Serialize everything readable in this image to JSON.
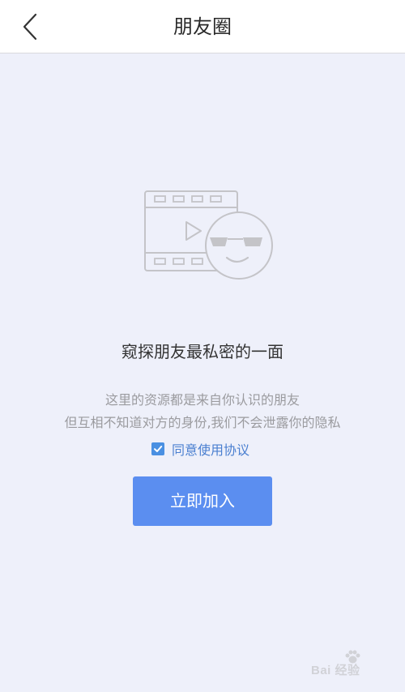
{
  "header": {
    "title": "朋友圈",
    "back_icon": "chevron-left-icon"
  },
  "illustration": {
    "icon": "video-film-sunglasses-face-icon"
  },
  "content": {
    "headline": "窥探朋友最私密的一面",
    "desc_line1": "这里的资源都是来自你认识的朋友",
    "desc_line2": "但互相不知道对方的身份,我们不会泄露你的隐私"
  },
  "agreement": {
    "checked": true,
    "label": "同意使用协议"
  },
  "join_button": {
    "label": "立即加入"
  },
  "watermark": {
    "text": "Bai 经验"
  },
  "colors": {
    "background": "#eef0fa",
    "accent": "#5b8ef0",
    "link": "#4a7fd0"
  }
}
